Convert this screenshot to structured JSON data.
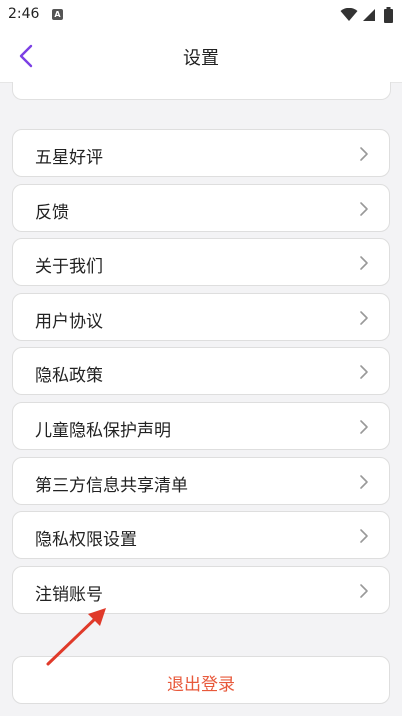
{
  "status_bar": {
    "time": "2:46",
    "notification_icon": "a-icon",
    "icons": [
      "wifi-icon",
      "signal-icon",
      "battery-icon"
    ]
  },
  "header": {
    "title": "设置",
    "back_icon": "chevron-left-icon",
    "back_color": "#7b3fe4"
  },
  "settings_list": {
    "items": [
      {
        "label": "五星好评"
      },
      {
        "label": "反馈"
      },
      {
        "label": "关于我们"
      },
      {
        "label": "用户协议"
      },
      {
        "label": "隐私政策"
      },
      {
        "label": "儿童隐私保护声明"
      },
      {
        "label": "第三方信息共享清单"
      },
      {
        "label": "隐私权限设置"
      },
      {
        "label": "注销账号"
      }
    ],
    "chevron_icon": "chevron-right-icon"
  },
  "logout": {
    "label": "退出登录",
    "color": "#e8593b"
  },
  "annotation": {
    "type": "red-arrow",
    "color": "#e03a2a",
    "points_to": "注销账号"
  }
}
